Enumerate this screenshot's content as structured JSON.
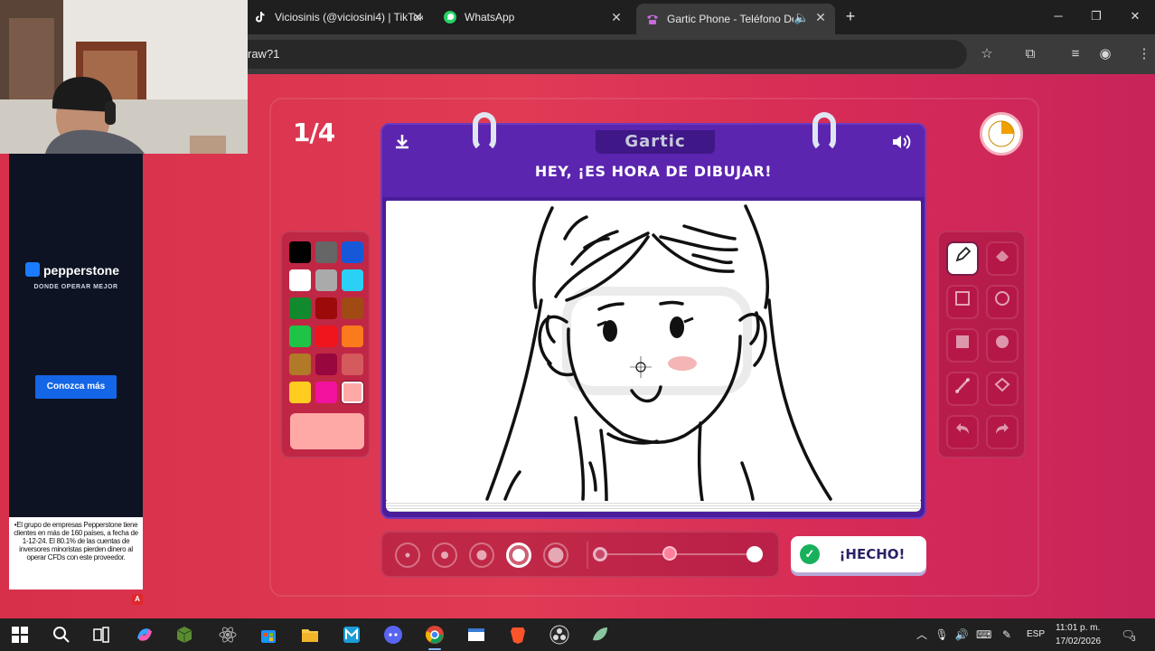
{
  "browser": {
    "tabs": [
      {
        "title": "Viciosinis (@viciosini4) | TikTok",
        "active": false
      },
      {
        "title": "WhatsApp",
        "active": false
      },
      {
        "title": "Gartic Phone - Teléfono De",
        "active": true
      }
    ],
    "url_fragment": "raw?1",
    "window_controls": {
      "minimize": "─",
      "restore": "❐",
      "close": "✕"
    },
    "new_tab_symbol": "+",
    "icons": [
      "star-icon",
      "extensions-icon",
      "media-icon",
      "profile-icon",
      "menu-icon"
    ]
  },
  "game": {
    "round_counter": "1/4",
    "logo_text": "Gartic",
    "prompt": "HEY, ¡ES HORA DE DIBUJAR!",
    "timer_fraction_elapsed": 0.25,
    "palette": [
      {
        "name": "black",
        "hex": "#000000"
      },
      {
        "name": "dark-gray",
        "hex": "#666666"
      },
      {
        "name": "blue",
        "hex": "#1658d8"
      },
      {
        "name": "white",
        "hex": "#ffffff"
      },
      {
        "name": "light-gray",
        "hex": "#aaaaaa"
      },
      {
        "name": "cyan",
        "hex": "#2ad0f5"
      },
      {
        "name": "green",
        "hex": "#118a2e"
      },
      {
        "name": "dark-red",
        "hex": "#9c0a0a"
      },
      {
        "name": "brown",
        "hex": "#a14a14"
      },
      {
        "name": "light-green",
        "hex": "#1ec446"
      },
      {
        "name": "red",
        "hex": "#f0141d"
      },
      {
        "name": "orange",
        "hex": "#fa7a1c"
      },
      {
        "name": "tan",
        "hex": "#b07a28"
      },
      {
        "name": "maroon",
        "hex": "#98083e"
      },
      {
        "name": "salmon",
        "hex": "#d45a5e"
      },
      {
        "name": "yellow",
        "hex": "#ffcd1f"
      },
      {
        "name": "magenta",
        "hex": "#f2129e"
      },
      {
        "name": "pink",
        "hex": "#ffa9a7"
      }
    ],
    "selected_color": "#ffa9a7",
    "tools": [
      "pencil-icon",
      "eraser-icon",
      "rectangle-outline-icon",
      "circle-outline-icon",
      "rectangle-filled-icon",
      "circle-filled-icon",
      "line-icon",
      "fill-bucket-icon",
      "undo-icon",
      "redo-icon"
    ],
    "active_tool": "pencil-icon",
    "brush_sizes": [
      1,
      2,
      3,
      4,
      5
    ],
    "selected_brush_size": 4,
    "opacity_fraction": 0.45,
    "done_label": "¡HECHO!",
    "check_symbol": "✓"
  },
  "ad": {
    "brand": "pepperstone",
    "tagline": "DONDE OPERAR MEJOR",
    "cta": "Conozca más",
    "disclaimer": "•El grupo de empresas Pepperstone tiene clientes en más de 160 países, a fecha de 1-12-24.  El 80.1% de las cuentas de inversores minoristas pierden dinero al operar CFDs con este proveedor.",
    "badge": "A"
  },
  "taskbar": {
    "language": "ESP",
    "time": "11:01 p. m.",
    "date": "17/02/2026",
    "notification_count": "3"
  }
}
